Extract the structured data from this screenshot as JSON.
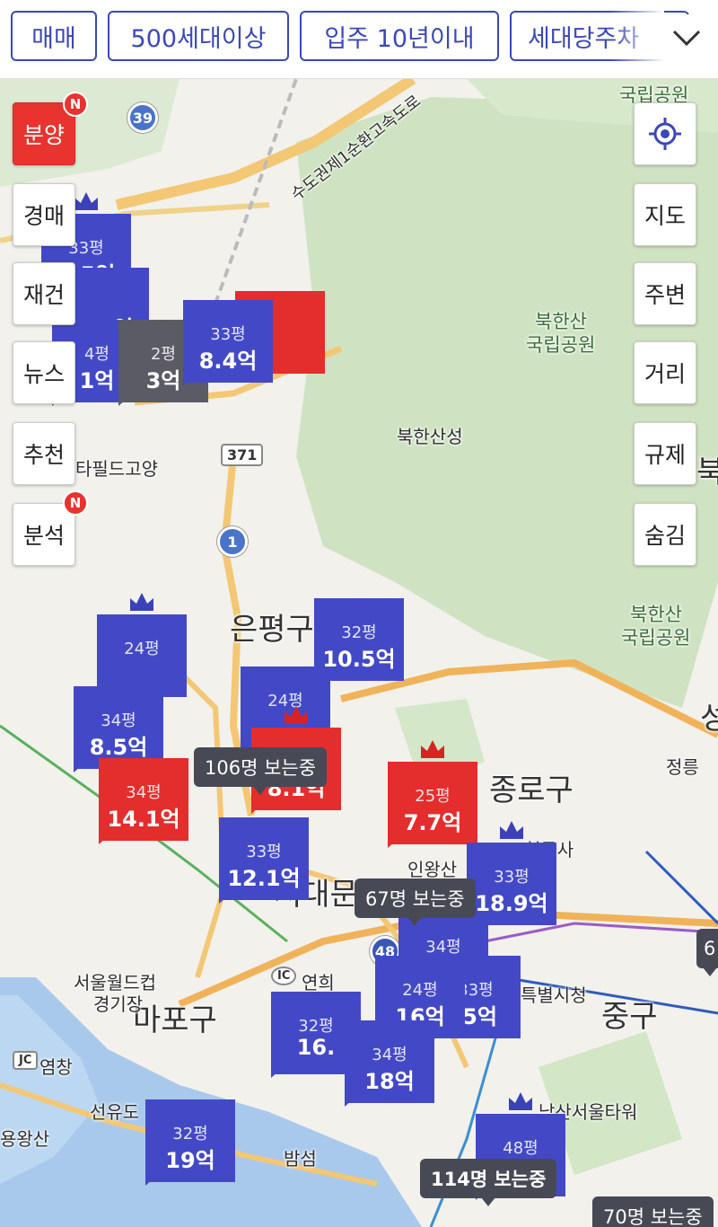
{
  "filters": {
    "chips": [
      "매매",
      "500세대이상",
      "입주 10년이내",
      "세대당주차"
    ]
  },
  "side_left": [
    {
      "label": "분양",
      "active": true,
      "badge": "N"
    },
    {
      "label": "경매"
    },
    {
      "label": "재건"
    },
    {
      "label": "뉴스"
    },
    {
      "label": "추천"
    },
    {
      "label": "분석",
      "badge": "N"
    }
  ],
  "side_right": [
    "지도",
    "주변",
    "거리",
    "규제",
    "숨김"
  ],
  "map_labels": {
    "eunpyeong": "은평구",
    "jongno": "종로구",
    "mapo": "마포구",
    "junggu": "중구",
    "seodaemun": "서대문",
    "bukhansan_park_1": "국립공원",
    "bukhansan_park_2a": "북한산",
    "bukhansan_park_2b": "국립공원",
    "bukhansan_park_3a": "북한산",
    "bukhansan_park_3b": "국립공원",
    "bukhansanseong": "북한산성",
    "expressway": "수도권제1순환고속도로",
    "starfield": "타필드고양",
    "jeongreung": "정릉",
    "cheongdong": "청동사",
    "inwangsan": "인왕산",
    "cityhall": "특별시청",
    "namsan_tower": "남산서울타워",
    "worldcup": "서울월드컵",
    "worldcup2": "경기장",
    "yeomchang": "염창",
    "seonyudo": "선유도",
    "yongwangsan": "용왕산",
    "bamseom": "밤섬",
    "yeonhui": "연희",
    "right_edge_1": "북",
    "right_edge_2": "성",
    "road_39": "39",
    "road_371": "371",
    "road_1": "1",
    "road_48": "48",
    "jc": "JC",
    "ic": "IC"
  },
  "markers": [
    {
      "area": "33평",
      "price": "7.5억",
      "color": "blue",
      "crown": true
    },
    {
      "area": "",
      "price": "6.7억",
      "color": "blue"
    },
    {
      "area": "4평",
      "price": "1억",
      "color": "blue"
    },
    {
      "area": "2평",
      "price": "3억",
      "color": "gray"
    },
    {
      "area": "33평",
      "price": "8.4억",
      "color": "blue"
    },
    {
      "area": "",
      "price": "",
      "color": "red"
    },
    {
      "area": "24평",
      "price": "",
      "color": "blue",
      "crown": true
    },
    {
      "area": "34평",
      "price": "8.5억",
      "color": "blue"
    },
    {
      "area": "32평",
      "price": "10.5억",
      "color": "blue"
    },
    {
      "area": "24평",
      "price": "",
      "color": "blue"
    },
    {
      "area": "34평",
      "price": "14.1억",
      "color": "red"
    },
    {
      "area": "",
      "price": "8.1억",
      "color": "red",
      "crown": true
    },
    {
      "area": "25평",
      "price": "7.7억",
      "color": "red",
      "crown": true
    },
    {
      "area": "33평",
      "price": "12.1억",
      "color": "blue"
    },
    {
      "area": "33평",
      "price": "18.9억",
      "color": "blue",
      "crown": true
    },
    {
      "area": "34평",
      "price": "",
      "color": "blue"
    },
    {
      "area": "24평",
      "price": "16억",
      "color": "blue"
    },
    {
      "area": "33평",
      "price": ".5억",
      "color": "blue"
    },
    {
      "area": "32평",
      "price": "16.",
      "color": "blue"
    },
    {
      "area": "34평",
      "price": "18억",
      "color": "blue"
    },
    {
      "area": "32평",
      "price": "19억",
      "color": "blue"
    },
    {
      "area": "48평",
      "price": "",
      "color": "blue",
      "crown": true
    }
  ],
  "viewing": [
    "106명 보는중",
    "67명 보는중",
    "114명 보는중",
    "70명 보는중"
  ],
  "right_edge_num": "6",
  "colors": {
    "brand_blue": "#3b48b7",
    "marker_blue": "#4349c6",
    "marker_red": "#e42d2d",
    "active_red": "#e8332f"
  }
}
